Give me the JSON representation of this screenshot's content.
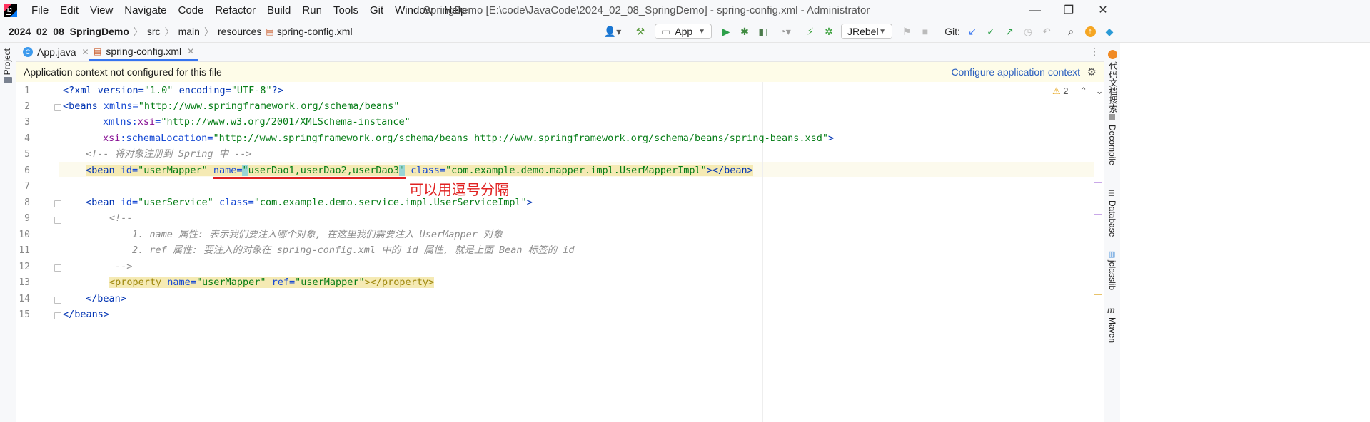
{
  "titlebar": {
    "menus": [
      "File",
      "Edit",
      "View",
      "Navigate",
      "Code",
      "Refactor",
      "Build",
      "Run",
      "Tools",
      "Git",
      "Window",
      "Help"
    ],
    "window_title": "SpringDemo [E:\\code\\JavaCode\\2024_02_08_SpringDemo] - spring-config.xml - Administrator",
    "minimize": "—",
    "restore": "❐",
    "close": "✕"
  },
  "navbar": {
    "project": "2024_02_08_SpringDemo",
    "crumbs": [
      "src",
      "main",
      "resources"
    ],
    "file": "spring-config.xml",
    "run_config": "App",
    "jrebel": "JRebel",
    "git_label": "Git:"
  },
  "left_strip": {
    "project_label": "Project"
  },
  "right_strip": {
    "items": [
      "代码文档搜索",
      "Decompile",
      "Database",
      "jclasslib",
      "Maven"
    ]
  },
  "tabs": [
    {
      "label": "App.java",
      "active": false
    },
    {
      "label": "spring-config.xml",
      "active": true
    }
  ],
  "banner": {
    "message": "Application context not configured for this file",
    "action": "Configure application context"
  },
  "editor": {
    "line_numbers": [
      "1",
      "2",
      "3",
      "4",
      "5",
      "6",
      "7",
      "8",
      "9",
      "10",
      "11",
      "12",
      "13",
      "14",
      "15"
    ],
    "warnings": "2",
    "annotation": "可以用逗号分隔",
    "lines": {
      "l1a": "<?xml version=",
      "l1b": "\"1.0\"",
      "l1c": " encoding=",
      "l1d": "\"UTF-8\"",
      "l1e": "?>",
      "l2a": "<beans ",
      "l2b": "xmlns=",
      "l2c": "\"http://www.springframework.org/schema/beans\"",
      "l3a": "xmlns:",
      "l3b": "xsi",
      "l3c": "=",
      "l3d": "\"http://www.w3.org/2001/XMLSchema-instance\"",
      "l4a": "xsi",
      "l4b": ":schemaLocation=",
      "l4c": "\"http://www.springframework.org/schema/beans http://www.springframework.org/schema/beans/spring-beans.xsd\"",
      "l4d": ">",
      "l5": "<!-- 将对象注册到 Spring 中 -->",
      "l6a": "<bean ",
      "l6b": "id=",
      "l6c": "\"userMapper\" ",
      "l6d": "name=",
      "l6e": "\"",
      "l6f": "userDao1,userDao2,userDao3",
      "l6g": "\"",
      "l6h": " class=",
      "l6i": "\"com.example.demo.mapper.impl.UserMapperImpl\"",
      "l6j": "></bean>",
      "l8a": "<bean ",
      "l8b": "id=",
      "l8c": "\"userService\" ",
      "l8d": "class=",
      "l8e": "\"com.example.demo.service.impl.UserServiceImpl\"",
      "l8f": ">",
      "l9": "<!--",
      "l10": "1. name 属性: 表示我们要注入哪个对象, 在这里我们需要注入 UserMapper 对象",
      "l11": "2. ref 属性: 要注入的对象在 spring-config.xml 中的 id 属性, 就是上面 Bean 标签的 id",
      "l12": "-->",
      "l13a": "<property ",
      "l13b": "name=",
      "l13c": "\"userMapper\" ",
      "l13d": "ref=",
      "l13e": "\"userMapper\"",
      "l13f": "></property>",
      "l14": "</bean>",
      "l15": "</beans>"
    }
  },
  "colors": {
    "accent": "#3574f0",
    "annotation": "#e02020",
    "banner_bg": "#fefce8"
  }
}
